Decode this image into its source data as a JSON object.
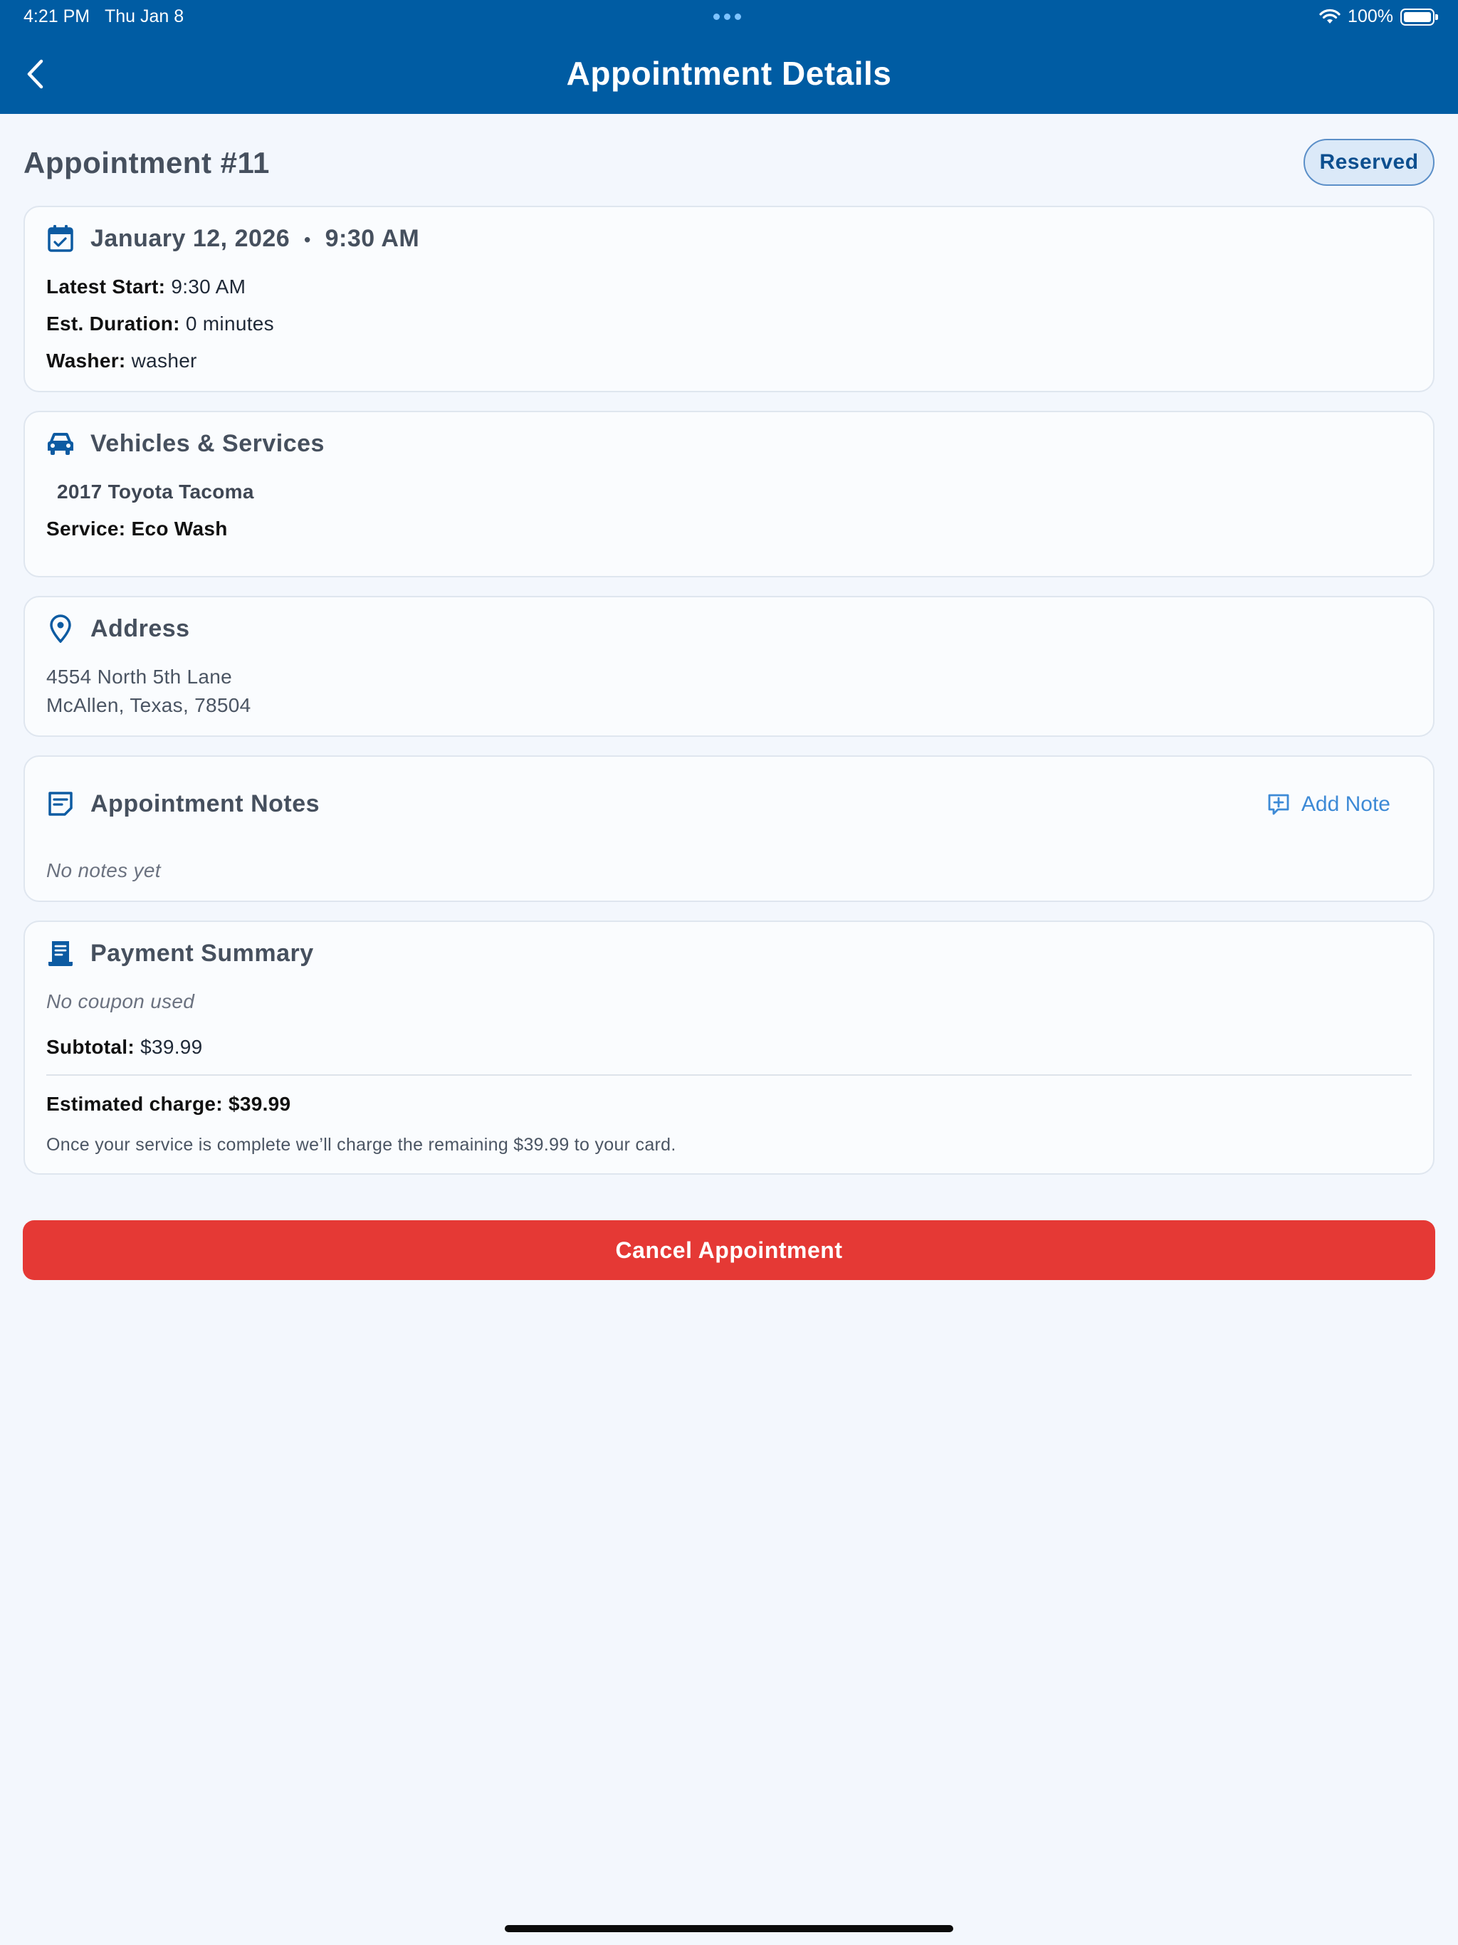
{
  "status_bar": {
    "time": "4:21 PM",
    "date": "Thu Jan 8",
    "battery": "100%"
  },
  "nav": {
    "title": "Appointment Details"
  },
  "appointment": {
    "title": "Appointment #11",
    "status": "Reserved"
  },
  "schedule": {
    "date": "January 12, 2026",
    "separator": "•",
    "time": "9:30 AM",
    "latest_start_label": "Latest Start:",
    "latest_start": "9:30 AM",
    "duration_label": "Est. Duration:",
    "duration": "0 minutes",
    "washer_label": "Washer:",
    "washer": "washer"
  },
  "vehicles": {
    "heading": "Vehicles & Services",
    "vehicle": "2017 Toyota Tacoma",
    "service_label": "Service:",
    "service": "Eco Wash"
  },
  "address": {
    "heading": "Address",
    "line1": "4554 North 5th Lane",
    "line2": "McAllen, Texas, 78504"
  },
  "notes": {
    "heading": "Appointment Notes",
    "add_label": "Add Note",
    "empty": "No notes yet"
  },
  "payment": {
    "heading": "Payment Summary",
    "coupon": "No coupon used",
    "subtotal_label": "Subtotal:",
    "subtotal": "$39.99",
    "estimated_label": "Estimated charge:",
    "estimated": "$39.99",
    "footnote": "Once your service is complete we’ll charge the remaining $39.99 to your card."
  },
  "actions": {
    "cancel_label": "Cancel Appointment"
  },
  "colors": {
    "header": "#005ca3",
    "accent": "#0d4f8f",
    "danger": "#e53935",
    "link": "#3d8ad6"
  }
}
